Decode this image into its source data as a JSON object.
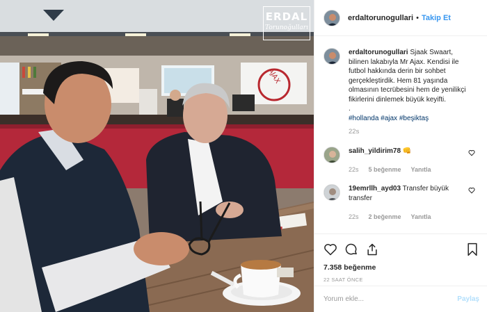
{
  "watermark": {
    "line1": "ERDAL",
    "line2": "Torunoğulları"
  },
  "header": {
    "username": "erdaltorunogullari",
    "separator": "•",
    "follow_label": "Takip Et"
  },
  "caption": {
    "username": "erdaltorunogullari",
    "text": "Sjaak Swaart, bilinen lakabıyla Mr Ajax. Kendisi ile futbol hakkında derin bir sohbet gerçekleştirdik. Hem 81 yaşında olmasının tecrübesini hem de yenilikçi fikirlerini dinlemek büyük keyifti.",
    "dot_line": ".",
    "hashtags": "#hollanda #ajax #beşiktaş",
    "age": "22s"
  },
  "comments": [
    {
      "username": "salih_yildirim78",
      "text": "👊",
      "age": "22s",
      "likes": "5 beğenme",
      "reply": "Yanıtla"
    },
    {
      "username": "19emrllh_ayd03",
      "text": "Transfer büyük transfer",
      "age": "22s",
      "likes": "2 beğenme",
      "reply": "Yanıtla"
    }
  ],
  "actions": {
    "likes": "7.358 beğenme",
    "time": "22 SAAT ÖNCE"
  },
  "add_comment": {
    "placeholder": "Yorum ekle...",
    "post_label": "Paylaş"
  },
  "colors": {
    "accent": "#3897f0",
    "hashtag": "#003569",
    "muted": "#999999",
    "post_disabled": "#b2dffc"
  },
  "icons": [
    "heart-icon",
    "comment-icon",
    "share-icon",
    "bookmark-icon"
  ]
}
